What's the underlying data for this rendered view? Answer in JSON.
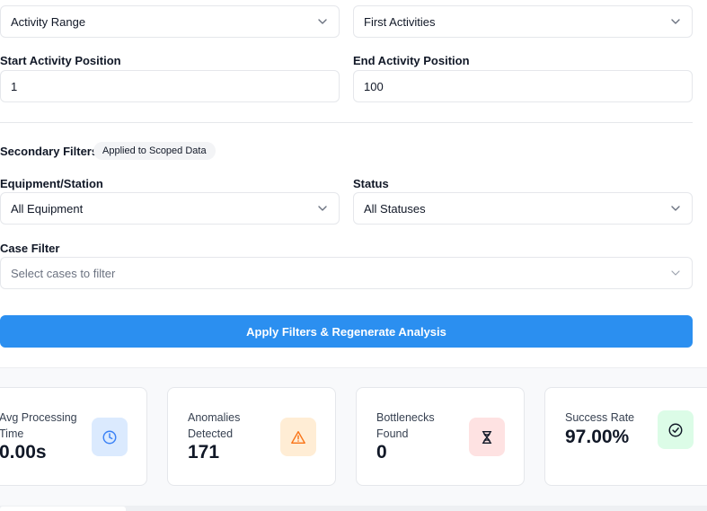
{
  "scope": {
    "range_mode": "Activity Range",
    "activity_mode": "First Activities",
    "start_label": "Start Activity Position",
    "start_value": "1",
    "end_label": "End Activity Position",
    "end_value": "100"
  },
  "secondary": {
    "title": "Secondary Filters",
    "badge": "Applied to Scoped Data",
    "equipment_label": "Equipment/Station",
    "equipment_value": "All Equipment",
    "status_label": "Status",
    "status_value": "All Statuses",
    "case_label": "Case Filter",
    "case_placeholder": "Select cases to filter"
  },
  "apply_button": "Apply Filters & Regenerate Analysis",
  "stats": [
    {
      "title": "Avg Processing Time",
      "value": "0.00s",
      "icon": "clock-icon",
      "icon_bg": "#dbeafe",
      "icon_color": "#3b82f6"
    },
    {
      "title": "Anomalies Detected",
      "value": "171",
      "icon": "warning-icon",
      "icon_bg": "#ffedd5",
      "icon_color": "#f97316"
    },
    {
      "title": "Bottlenecks Found",
      "value": "0",
      "icon": "hourglass-icon",
      "icon_bg": "#fee2e2",
      "icon_color": "#111827"
    },
    {
      "title": "Success Rate",
      "value": "97.00%",
      "icon": "check-circle-icon",
      "icon_bg": "#dcfce7",
      "icon_color": "#111827"
    }
  ],
  "colors": {
    "accent": "#2b8ff0",
    "border": "#e5e7eb"
  }
}
